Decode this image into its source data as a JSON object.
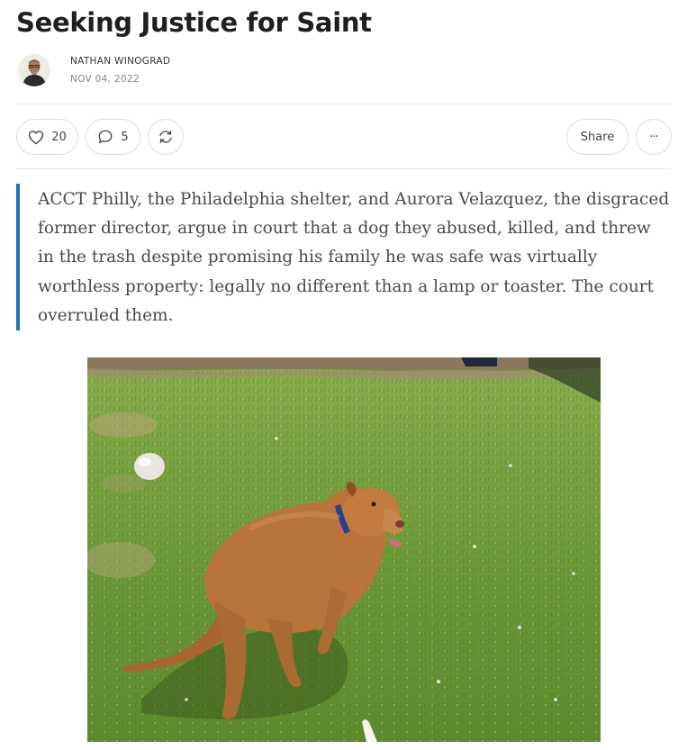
{
  "post": {
    "title": "Seeking Justice for Saint",
    "author": "NATHAN WINOGRAD",
    "date": "NOV 04, 2022"
  },
  "actions": {
    "like_count": "20",
    "comment_count": "5",
    "share_label": "Share",
    "more_label": "···"
  },
  "body": {
    "quote": "ACCT Philly, the Philadelphia shelter, and Aurora Velazquez, the disgraced former director, argue in court that a dog they abused, killed, and threw in the trash despite promising his family he was safe was virtually worthless property: legally no different than a lamp or toaster. The court overruled them."
  },
  "icons": {
    "like": "heart-icon",
    "comment": "comment-bubble-icon",
    "restack": "restack-icon",
    "more": "ellipsis-icon"
  },
  "colors": {
    "quote_bar": "#1a73b8",
    "divider": "#e6e6e6",
    "grass": "#6f9a3a",
    "dog": "#b8743a"
  }
}
